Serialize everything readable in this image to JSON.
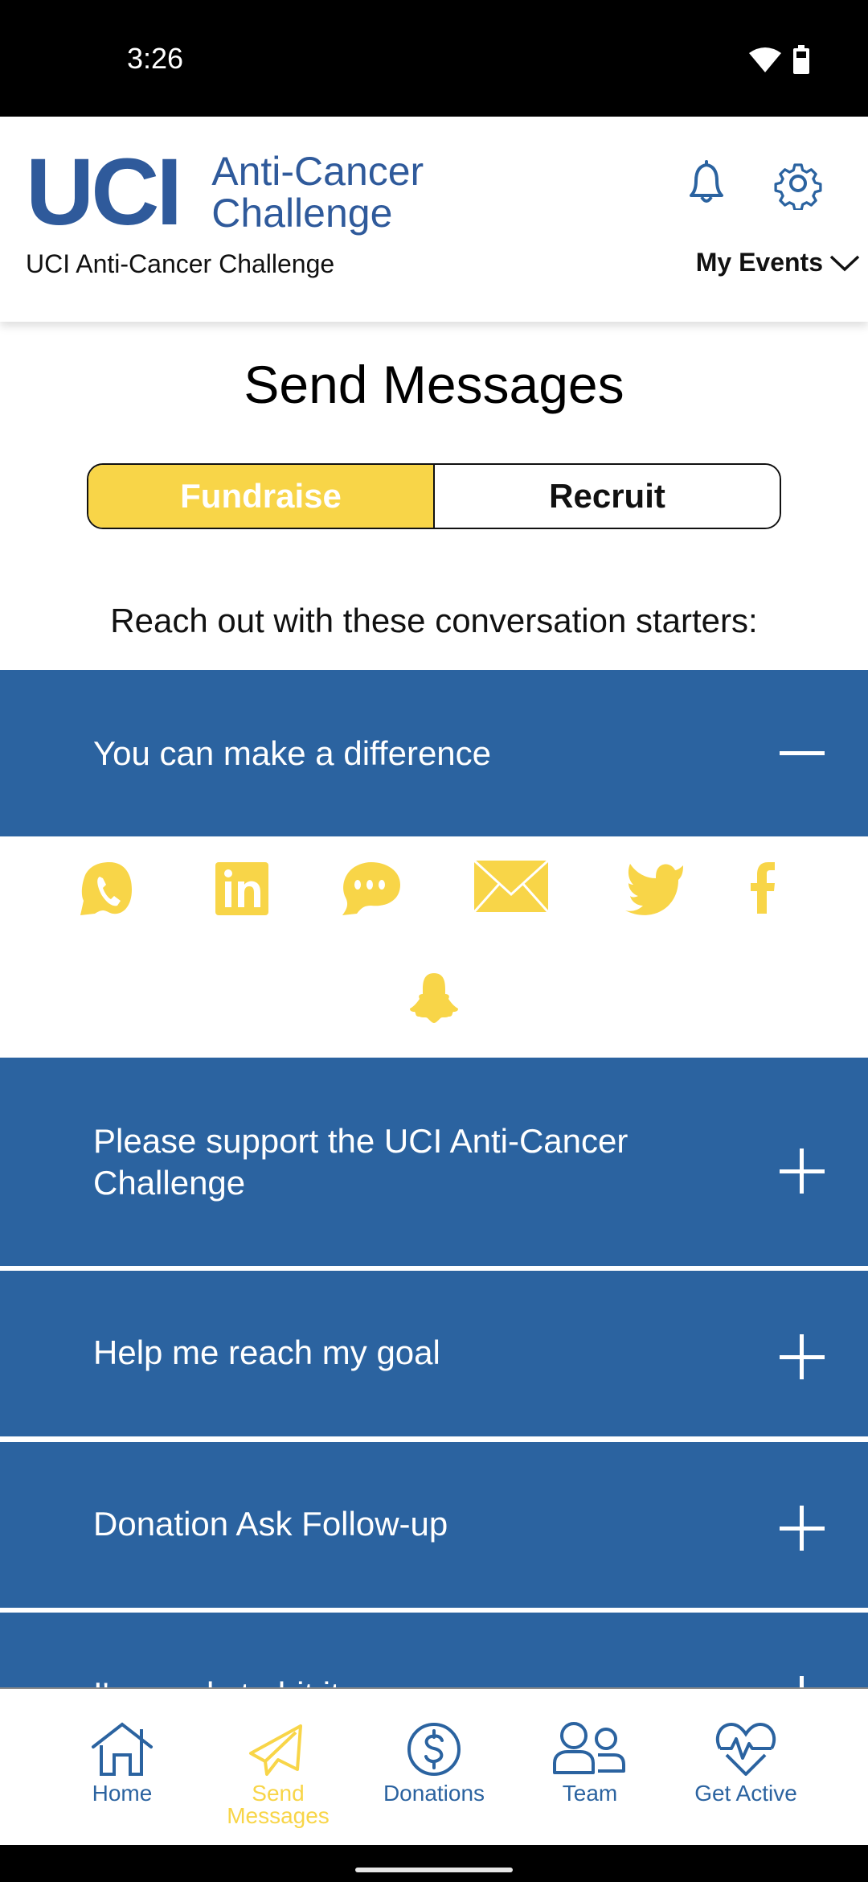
{
  "status_bar": {
    "time": "3:26",
    "icons": [
      "wifi-icon",
      "battery-icon"
    ]
  },
  "header": {
    "logo_mark": "UCI",
    "logo_text_line1": "Anti-Cancer",
    "logo_text_line2": "Challenge",
    "org_name": "UCI Anti-Cancer Challenge",
    "notifications_icon": "bell-icon",
    "settings_icon": "gear-icon",
    "events_menu_label": "My Events"
  },
  "page": {
    "title": "Send Messages",
    "segments": [
      {
        "label": "Fundraise",
        "selected": true
      },
      {
        "label": "Recruit",
        "selected": false
      }
    ],
    "intro": "Reach out with these conversation starters:"
  },
  "accordion": {
    "items": [
      {
        "label": "You can make a difference",
        "expanded": true,
        "toggle": "minus-icon"
      },
      {
        "label": "Please support the UCI Anti-Cancer Challenge",
        "expanded": false,
        "toggle": "plus-icon"
      },
      {
        "label": "Help me reach my goal",
        "expanded": false,
        "toggle": "plus-icon"
      },
      {
        "label": "Donation Ask Follow-up",
        "expanded": false,
        "toggle": "plus-icon"
      },
      {
        "label": "I'm ready to hit it",
        "expanded": false,
        "toggle": "plus-icon"
      }
    ],
    "share_channels": [
      "whatsapp",
      "linkedin",
      "sms",
      "email",
      "twitter",
      "facebook",
      "snapchat"
    ]
  },
  "tabbar": {
    "items": [
      {
        "label": "Home",
        "icon": "home-icon",
        "active": false
      },
      {
        "label": "Send Messages",
        "icon": "paper-plane-icon",
        "active": true
      },
      {
        "label": "Donations",
        "icon": "dollar-circle-icon",
        "active": false
      },
      {
        "label": "Team",
        "icon": "team-icon",
        "active": false
      },
      {
        "label": "Get Active",
        "icon": "heartbeat-icon",
        "active": false
      }
    ]
  },
  "colors": {
    "brand_blue": "#2b63a0",
    "logo_blue": "#2f5a9b",
    "accent_yellow": "#f8d548",
    "text_dark": "#111111"
  }
}
